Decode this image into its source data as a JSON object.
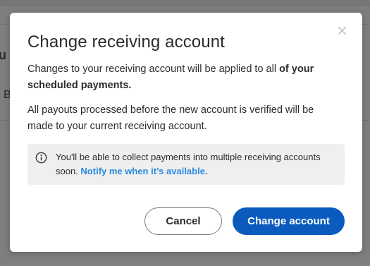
{
  "background": {
    "fragment_1": "u",
    "fragment_2": "B"
  },
  "modal": {
    "title": "Change receiving account",
    "close_icon": "×",
    "paragraph_1_prefix": "Changes to your receiving account will be applied to all ",
    "paragraph_1_bold": "of your scheduled payments.",
    "paragraph_2": "All payouts processed before the new account is verified will be made to your current receiving account.",
    "notice": {
      "icon": "info-icon",
      "text": "You'll be able to collect payments into multiple receiving accounts soon. ",
      "link": "Notify me when it’s available."
    },
    "cancel_label": "Cancel",
    "confirm_label": "Change account"
  },
  "colors": {
    "primary": "#0a5bbd",
    "link": "#2a8ae0",
    "overlay": "#7f7f7f",
    "notice_bg": "#efefef"
  }
}
